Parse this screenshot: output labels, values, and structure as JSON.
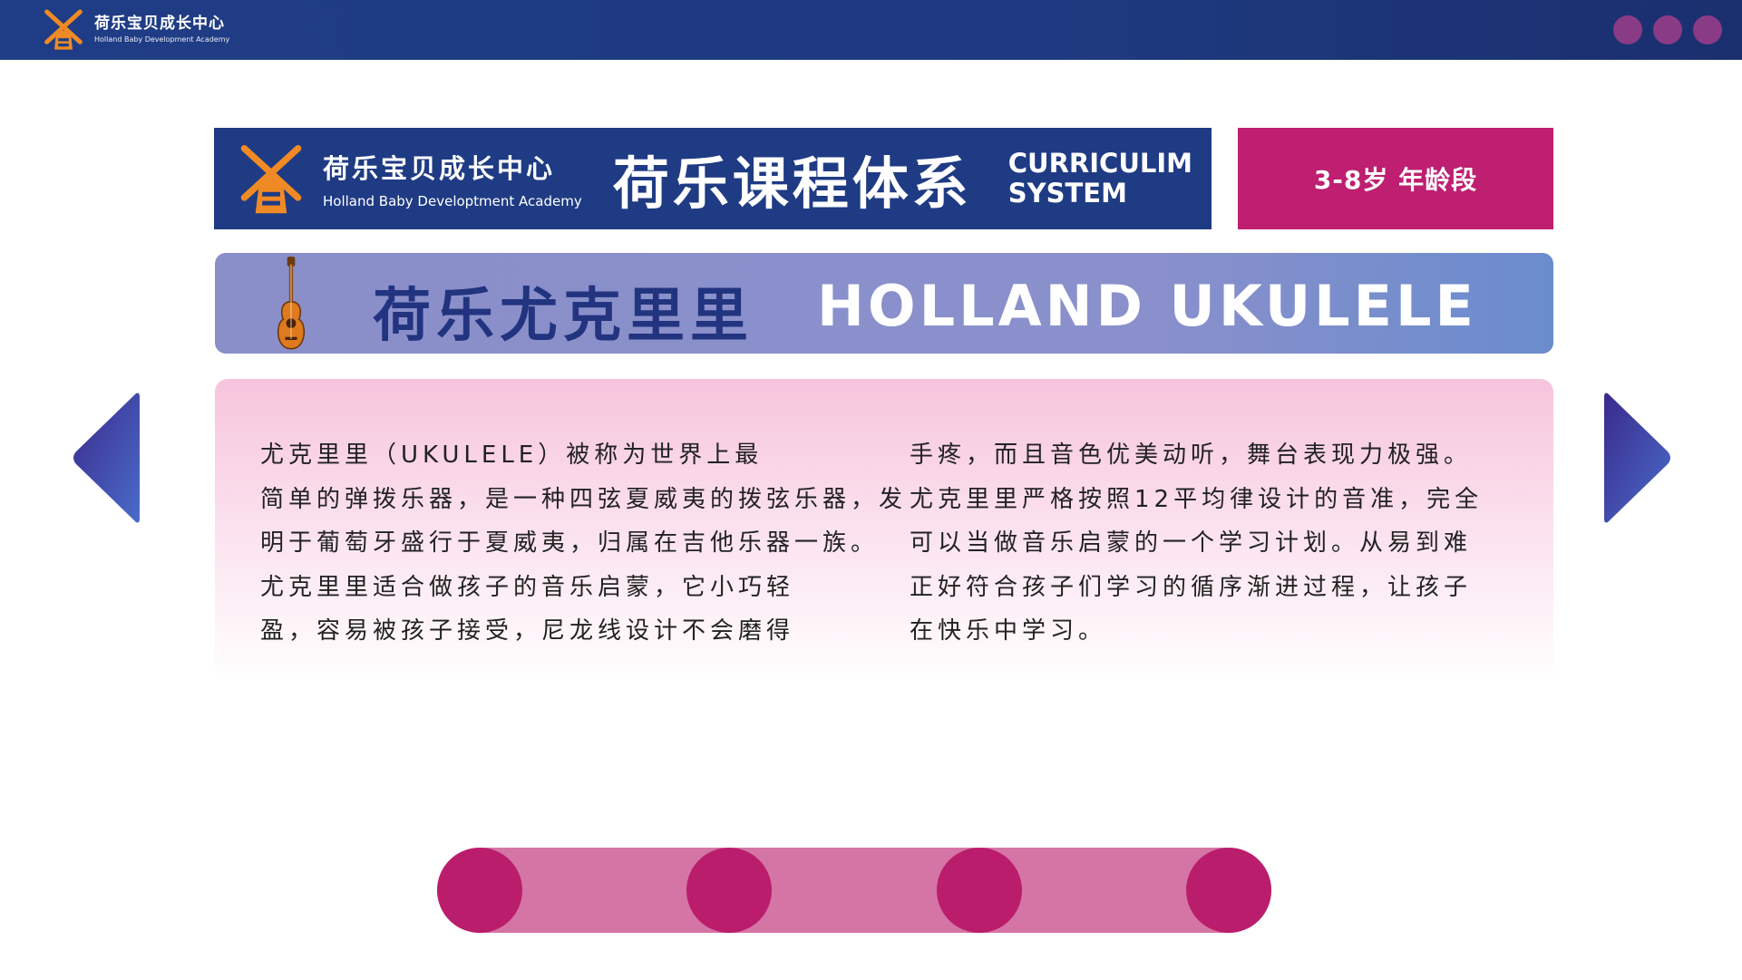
{
  "header": {
    "brand_cn": "荷乐宝贝成长中心",
    "brand_en": "Holland Baby Development Academy",
    "dots": [
      "#8a3b86",
      "#8a3b86",
      "#8a3b86"
    ]
  },
  "title_block": {
    "brand_cn": "荷乐宝贝成长中心",
    "brand_en": "Holland Baby Developtment Academy",
    "main_title": "荷乐课程体系",
    "sub_title_line1": "CURRICULIM",
    "sub_title_line2": "SYSTEM"
  },
  "age_badge": "3-8岁  年龄段",
  "course": {
    "title_cn": "荷乐尤克里里",
    "title_en": "HOLLAND UKULELE",
    "icon": "ukulele-icon"
  },
  "description": {
    "left_lines": [
      "尤克里里（UKULELE）被称为世界上最",
      "简单的弹拨乐器，是一种四弦夏威夷的拨弦乐器，发",
      "明于葡萄牙盛行于夏威夷，归属在吉他乐器一族。",
      "尤克里里适合做孩子的音乐启蒙，它小巧轻",
      "盈，容易被孩子接受，尼龙线设计不会磨得"
    ],
    "right_lines": [
      "手疼，而且音色优美动听，舞台表现力极强。",
      "尤克里里严格按照12平均律设计的音准，完全",
      "可以当做音乐启蒙的一个学习计划。从易到难",
      "正好符合孩子们学习的循序渐进过程，让孩子",
      "在快乐中学习。"
    ]
  },
  "navigation": {
    "prev_icon": "triangle-left-icon",
    "next_icon": "triangle-right-icon"
  },
  "stepper": {
    "steps": 4
  },
  "colors": {
    "navy": "#1f3b84",
    "magenta": "#be1f70",
    "periwinkle": "#8a8fc9",
    "orange": "#f08a24",
    "pink": "#d475a5"
  }
}
